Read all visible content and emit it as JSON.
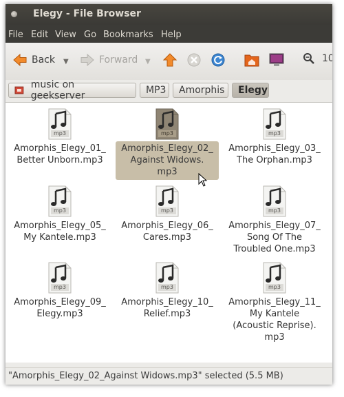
{
  "window": {
    "title": "Elegy - File Browser"
  },
  "menu": [
    "File",
    "Edit",
    "View",
    "Go",
    "Bookmarks",
    "Help"
  ],
  "toolbar": {
    "back_label": "Back",
    "forward_label": "Forward",
    "zoom_partial": "10"
  },
  "pathbar": {
    "crumbs": [
      "music on geekserver",
      "MP3",
      "Amorphis",
      "Elegy"
    ]
  },
  "icon_badge": "mp3",
  "files": [
    {
      "name": "Amorphis_Elegy_01_\nBetter Unborn.mp3",
      "selected": false
    },
    {
      "name": "Amorphis_Elegy_02_\nAgainst Widows.\nmp3",
      "selected": true
    },
    {
      "name": "Amorphis_Elegy_03_\nThe Orphan.mp3",
      "selected": false
    },
    {
      "name": "Amorphis_Elegy_05_\nMy Kantele.mp3",
      "selected": false
    },
    {
      "name": "Amorphis_Elegy_06_\nCares.mp3",
      "selected": false
    },
    {
      "name": "Amorphis_Elegy_07_\nSong Of The\nTroubled One.mp3",
      "selected": false
    },
    {
      "name": "Amorphis_Elegy_09_\nElegy.mp3",
      "selected": false
    },
    {
      "name": "Amorphis_Elegy_10_\nRelief.mp3",
      "selected": false
    },
    {
      "name": "Amorphis_Elegy_11_\nMy Kantele\n(Acoustic Reprise).\nmp3",
      "selected": false
    }
  ],
  "status": {
    "text": "\"Amorphis_Elegy_02_Against Widows.mp3\" selected (5.5 MB)"
  },
  "colors": {
    "selection": "#c8bea8",
    "titlebar": "#3c3b37",
    "accent_orange": "#e4661c"
  }
}
